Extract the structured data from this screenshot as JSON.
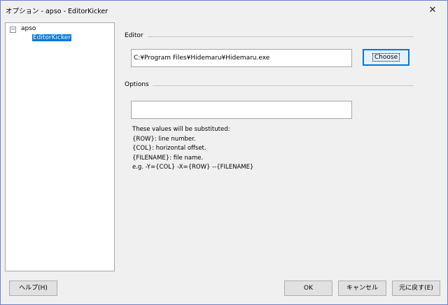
{
  "window": {
    "title": "オプション - apso - EditorKicker",
    "close_glyph": "✕"
  },
  "tree": {
    "expander_glyph": "−",
    "root": "apso",
    "child": "EditorKicker"
  },
  "editor": {
    "group_label": "Editor",
    "path_value": "C:¥Program Files¥Hidemaru¥Hidemaru.exe",
    "choose_label": "Choose"
  },
  "options": {
    "group_label": "Options",
    "value": "",
    "help": [
      "These values will be substituted:",
      " {ROW}: line number.",
      " {COL}: horizontal offset.",
      " {FILENAME}: file name.",
      "e.g. -Y={COL} -X={ROW} --{FILENAME}"
    ]
  },
  "buttons": {
    "help": "ヘルプ(H)",
    "ok": "OK",
    "cancel": "キャンセル",
    "reset": "元に戻す(E)"
  },
  "colors": {
    "selection": "#0078d7",
    "window_bg": "#f0f0f0",
    "default_button_border": "#0078d7"
  }
}
